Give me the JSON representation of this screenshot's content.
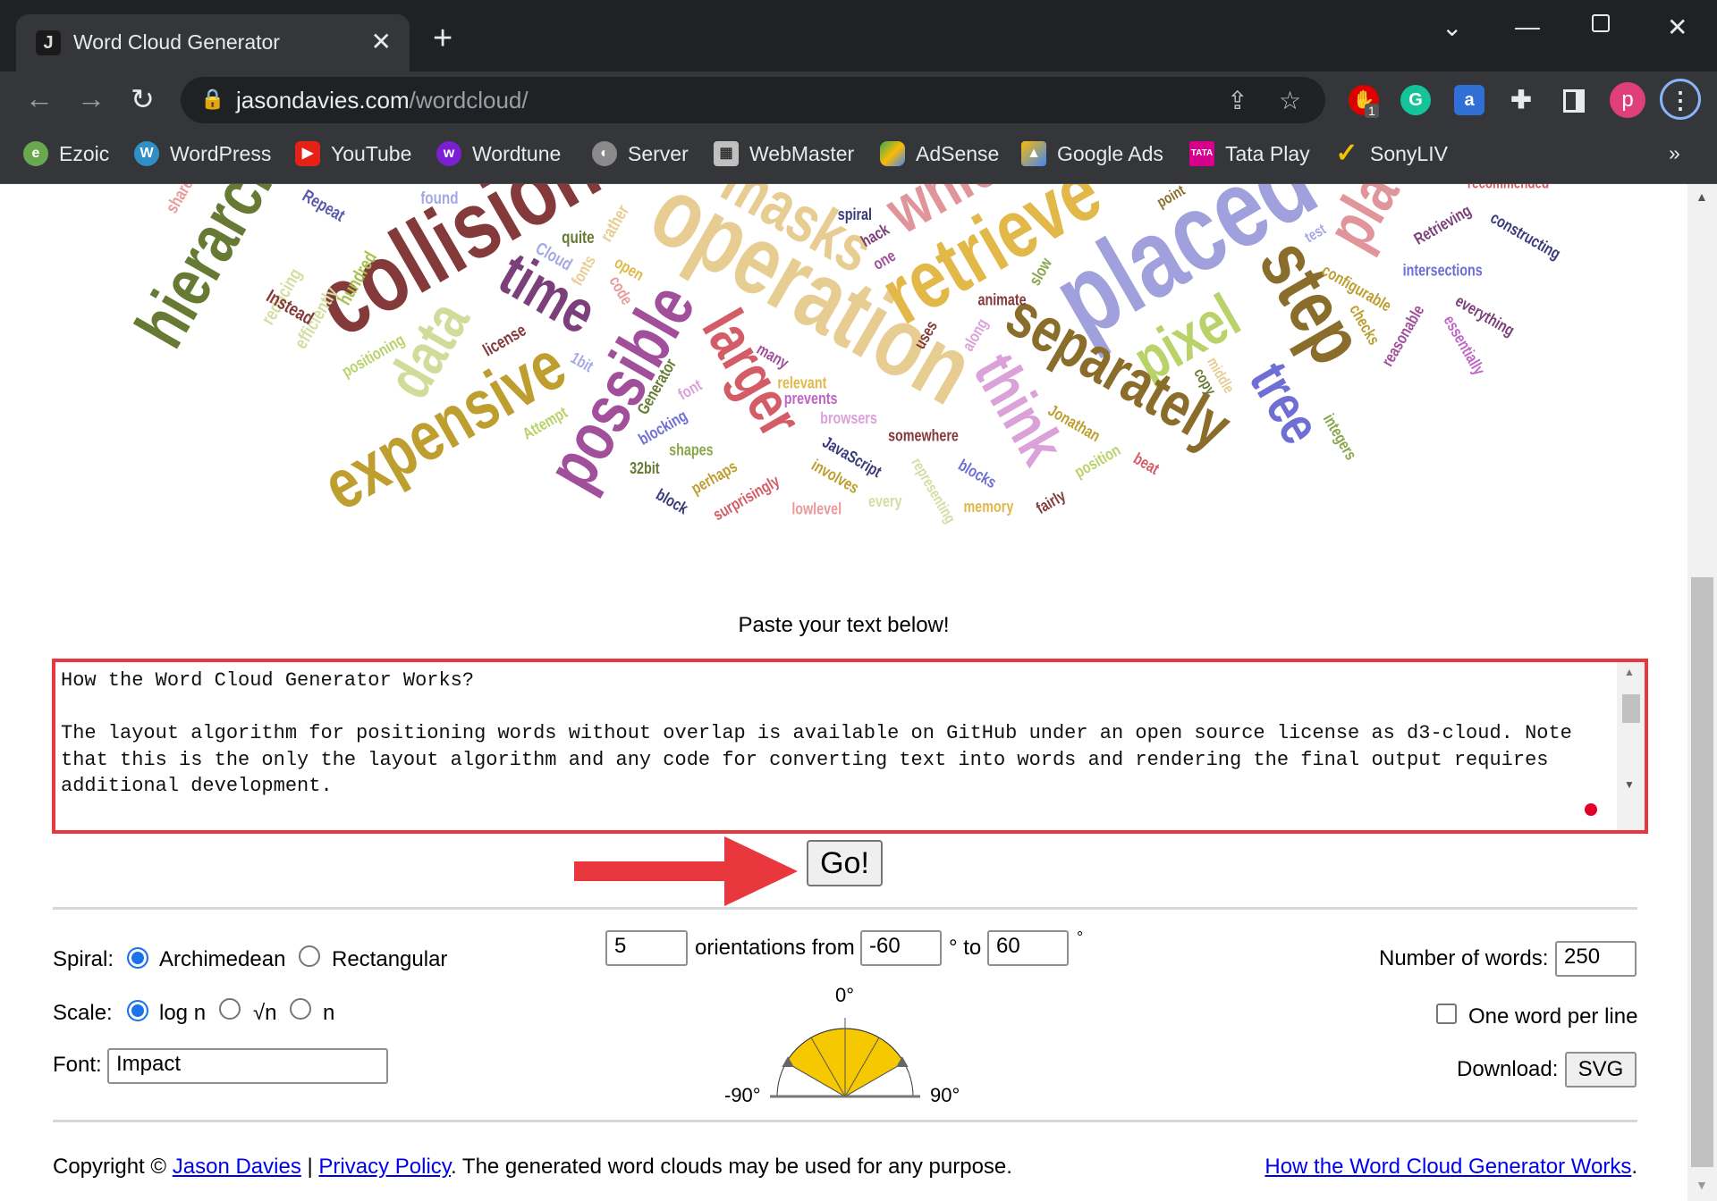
{
  "browser": {
    "tab_title": "Word Cloud Generator",
    "tab_favicon": "J",
    "url_host": "jasondavies.com",
    "url_path": "/wordcloud/",
    "extension_badge": "1",
    "profile_initial": "p",
    "bookmarks": [
      {
        "label": "Ezoic",
        "icon": "ezoic-icon",
        "color": "#6aa84f"
      },
      {
        "label": "WordPress",
        "icon": "wordpress-icon",
        "color": "#2f8fc7"
      },
      {
        "label": "YouTube",
        "icon": "youtube-icon",
        "color": "#e62117"
      },
      {
        "label": "Wordtune",
        "icon": "wordtune-icon",
        "color": "#7a1fd1"
      },
      {
        "label": "Server",
        "icon": "globe-icon",
        "color": "#8a8a8a"
      },
      {
        "label": "WebMaster",
        "icon": "webmaster-icon",
        "color": "#c0c0c0"
      },
      {
        "label": "AdSense",
        "icon": "adsense-icon",
        "color": "#f4b400"
      },
      {
        "label": "Google Ads",
        "icon": "google-ads-icon",
        "color": "#4285f4"
      },
      {
        "label": "Tata Play",
        "icon": "tata-play-icon",
        "color": "#d6008d"
      },
      {
        "label": "SonyLIV",
        "icon": "sonyliv-icon",
        "color": "#f2c200"
      }
    ],
    "more_bookmarks": "»"
  },
  "cloud": {
    "words": [
      {
        "text": "hierarchical",
        "color": "#677a34"
      },
      {
        "text": "collision",
        "color": "#843a3a"
      },
      {
        "text": "time",
        "color": "#7b3f7a"
      },
      {
        "text": "data",
        "color": "#cfdc9a"
      },
      {
        "text": "expensive",
        "color": "#bd9e2f"
      },
      {
        "text": "possible",
        "color": "#a14f9b"
      },
      {
        "text": "larger",
        "color": "#d45c66"
      },
      {
        "text": "operation",
        "color": "#e7cd91"
      },
      {
        "text": "masks",
        "color": "#e7cd91"
      },
      {
        "text": "retrieve",
        "color": "#e2b848"
      },
      {
        "text": "which",
        "color": "#e0959b"
      },
      {
        "text": "placed",
        "color": "#9fa0dc"
      },
      {
        "text": "placing",
        "color": "#e0959b"
      },
      {
        "text": "step",
        "color": "#8a6d2b"
      },
      {
        "text": "pixel",
        "color": "#b9d36a"
      },
      {
        "text": "separately",
        "color": "#8a6d2b"
      },
      {
        "text": "think",
        "color": "#dba1d9"
      },
      {
        "text": "tree",
        "color": "#6e6ed4"
      },
      {
        "text": "found",
        "color": "#a6a8e6"
      },
      {
        "text": "Repeat",
        "color": "#5a5aaa"
      },
      {
        "text": "shared",
        "color": "#e99a9a"
      },
      {
        "text": "reducing",
        "color": "#d3dea3"
      },
      {
        "text": "efficiently",
        "color": "#d3dea3"
      },
      {
        "text": "hundred",
        "color": "#a6c24d"
      },
      {
        "text": "Instead",
        "color": "#843a3a"
      },
      {
        "text": "quite",
        "color": "#677a34"
      },
      {
        "text": "rather",
        "color": "#e7cd91"
      },
      {
        "text": "Cloud",
        "color": "#a6a8e6"
      },
      {
        "text": "fonts",
        "color": "#e7cd91"
      },
      {
        "text": "open",
        "color": "#e2b848"
      },
      {
        "text": "code",
        "color": "#e99a9a"
      },
      {
        "text": "license",
        "color": "#843a3a"
      },
      {
        "text": "positioning",
        "color": "#b9d36a"
      },
      {
        "text": "1bit",
        "color": "#a6a8e6"
      },
      {
        "text": "Attempt",
        "color": "#b9d36a"
      },
      {
        "text": "Generator",
        "color": "#677a34"
      },
      {
        "text": "font",
        "color": "#dba1d9"
      },
      {
        "text": "relevant",
        "color": "#e2b848"
      },
      {
        "text": "prevents",
        "color": "#c064c6"
      },
      {
        "text": "many",
        "color": "#a14f9b"
      },
      {
        "text": "browsers",
        "color": "#dba1d9"
      },
      {
        "text": "blocking",
        "color": "#6e6ed4"
      },
      {
        "text": "shapes",
        "color": "#8aa64a"
      },
      {
        "text": "32bit",
        "color": "#677a34"
      },
      {
        "text": "perhaps",
        "color": "#bd9e2f"
      },
      {
        "text": "block",
        "color": "#3a3a7a"
      },
      {
        "text": "surprisingly",
        "color": "#d45c66"
      },
      {
        "text": "lowlevel",
        "color": "#e99a9a"
      },
      {
        "text": "JavaScript",
        "color": "#3a3a7a"
      },
      {
        "text": "involves",
        "color": "#bd9e2f"
      },
      {
        "text": "every",
        "color": "#d3dea3"
      },
      {
        "text": "representing",
        "color": "#d3dea3"
      },
      {
        "text": "somewhere",
        "color": "#843a3a"
      },
      {
        "text": "memory",
        "color": "#e2b848"
      },
      {
        "text": "blocks",
        "color": "#6e6ed4"
      },
      {
        "text": "fairly",
        "color": "#843a3a"
      },
      {
        "text": "position",
        "color": "#b9d36a"
      },
      {
        "text": "beat",
        "color": "#d45c66"
      },
      {
        "text": "Jonathan",
        "color": "#bd9e2f"
      },
      {
        "text": "spiral",
        "color": "#3a3a7a"
      },
      {
        "text": "hack",
        "color": "#7b3f7a"
      },
      {
        "text": "one",
        "color": "#a14f9b"
      },
      {
        "text": "animate",
        "color": "#843a3a"
      },
      {
        "text": "slow",
        "color": "#8aa64a"
      },
      {
        "text": "uses",
        "color": "#843a3a"
      },
      {
        "text": "along",
        "color": "#dba1d9"
      },
      {
        "text": "point",
        "color": "#8a6d2b"
      },
      {
        "text": "test",
        "color": "#a6a8e6"
      },
      {
        "text": "Retrieving",
        "color": "#7b3f7a"
      },
      {
        "text": "constructing",
        "color": "#3a3a7a"
      },
      {
        "text": "intersections",
        "color": "#6e6ed4"
      },
      {
        "text": "configurable",
        "color": "#bd9e2f"
      },
      {
        "text": "checks",
        "color": "#bd9e2f"
      },
      {
        "text": "reasonable",
        "color": "#a14f9b"
      },
      {
        "text": "everything",
        "color": "#7b3f7a"
      },
      {
        "text": "essentially",
        "color": "#c064c6"
      },
      {
        "text": "copy",
        "color": "#677a34"
      },
      {
        "text": "middle",
        "color": "#e7cd91"
      },
      {
        "text": "integers",
        "color": "#8aa64a"
      },
      {
        "text": "recommended",
        "color": "#d45c66"
      }
    ]
  },
  "main": {
    "paste_prompt": "Paste your text below!",
    "text_input": "How the Word Cloud Generator Works?\n\nThe layout algorithm for positioning words without overlap is available on GitHub under an open source license as d3-cloud. Note that this is the only the layout algorithm and any code for converting text into words and rendering the final output requires additional development.",
    "go_label": "Go!",
    "annotation_color": "#e8383d"
  },
  "controls": {
    "spiral_label": "Spiral:",
    "spiral_options": [
      "Archimedean",
      "Rectangular"
    ],
    "spiral_selected": "Archimedean",
    "scale_label": "Scale:",
    "scale_options": [
      "log n",
      "√n",
      "n"
    ],
    "scale_selected": "log n",
    "font_label": "Font:",
    "font_value": "Impact",
    "orientations_value": "5",
    "orientations_from_label": "orientations from",
    "from_value": "-60",
    "degree_to_label": "° to",
    "to_value": "60",
    "degree_symbol": "°",
    "angle_labels": {
      "top": "0°",
      "left": "-90°",
      "right": "90°"
    },
    "angle_fill": "#f5c800",
    "num_words_label": "Number of words:",
    "num_words_value": "250",
    "one_word_label": "One word per line",
    "one_word_checked": false,
    "download_label": "Download:",
    "svg_button": "SVG"
  },
  "footer": {
    "copyright": "Copyright ©",
    "author_link": "Jason Davies",
    "separator": "|",
    "privacy_link": "Privacy Policy",
    "notice": ". The generated word clouds may be used for any purpose.",
    "how_link": "How the Word Cloud Generator Works",
    "period": "."
  }
}
